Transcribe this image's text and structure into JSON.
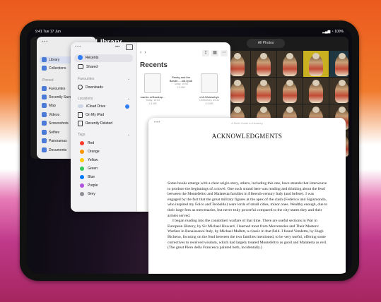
{
  "status": {
    "time": "9:41",
    "date": "Tue 17 Jun",
    "battery": "100%"
  },
  "photos": {
    "title": "Library",
    "view_toggle": "All Photos",
    "sidebar": {
      "items": [
        {
          "label": "Library",
          "icon": "photo-library-icon",
          "selected": true
        },
        {
          "label": "Collections",
          "icon": "collections-icon"
        }
      ],
      "pinned_header": "Pinned",
      "pinned": [
        "Favourites",
        "Recently Saved",
        "Map",
        "Videos",
        "Screenshots",
        "Selfies",
        "Panoramas",
        "Documents"
      ]
    }
  },
  "files": {
    "sidebar": {
      "top": [
        {
          "label": "Recents",
          "icon": "clock-icon",
          "selected": true
        },
        {
          "label": "Shared",
          "icon": "shared-icon"
        }
      ],
      "favourites_header": "Favourites",
      "favourites": [
        {
          "label": "Downloads",
          "icon": "download-icon"
        }
      ],
      "locations_header": "Locations",
      "locations": [
        {
          "label": "iCloud Drive",
          "icon": "cloud-icon"
        },
        {
          "label": "On My iPad",
          "icon": "ipad-icon"
        },
        {
          "label": "Recently Deleted",
          "icon": "trash-icon"
        }
      ],
      "tags_header": "Tags",
      "tags": [
        {
          "label": "Red",
          "color": "#ff3b30"
        },
        {
          "label": "Orange",
          "color": "#ff9500"
        },
        {
          "label": "Yellow",
          "color": "#ffcc00"
        },
        {
          "label": "Green",
          "color": "#34c759"
        },
        {
          "label": "Blue",
          "color": "#007aff"
        },
        {
          "label": "Purple",
          "color": "#af52de"
        },
        {
          "label": "Grey",
          "color": "#8e8e93"
        }
      ]
    },
    "main": {
      "title": "Recents",
      "files": [
        {
          "name": "marvin-m3backup...",
          "meta1": "Today, 10:54",
          "meta2": "1.5 MB"
        },
        {
          "name": "Pernty and the Bandit -...old.epub",
          "meta1": "Today, 10:54",
          "meta2": "1.5 MB"
        },
        {
          "name": "ch1-Wolesebyk",
          "meta1": "10/09/2023, 20:41",
          "meta2": "4.5 MB"
        }
      ]
    }
  },
  "book": {
    "header": "A Field Guide to Heraldry",
    "title": "ACKNOWLEDGMENTS",
    "paragraphs": [
      "Some books emerge with a clear origin story, others, including this one, have strands that interweave to produce the beginnings of a novel. One such strand here was reading and thinking about the feud between the Montefeltro and Malatesta families in fifteenth-century Italy (and before). I was engaged by the fact that the great military figures at the apex of the clash (Federico and Sigismondo, who inspired my Folco and Teobaldo) were lords of small cities, minor ones. Wealthy enough, due to their large fees as mercenaries, but never truly powerful compared to the city-states they and their armies served.",
      "I began reading into the condottieri warfare of that time. There are useful sections in War in European History, by Sir Michael Howard. I learned most from Mercenaries and Their Masters: Warfare in Renaissance Italy, by Michael Mallett, a classic in that field. I found Vendetta, by Hugh Bicheno, focusing on the feud between the two families mentioned, to be very useful, offering some correctives to received wisdom, which had largely treated Montefeltro as good and Malatesta as evil. (The great Piero della Francesca painted both, incidentally.)"
    ]
  }
}
